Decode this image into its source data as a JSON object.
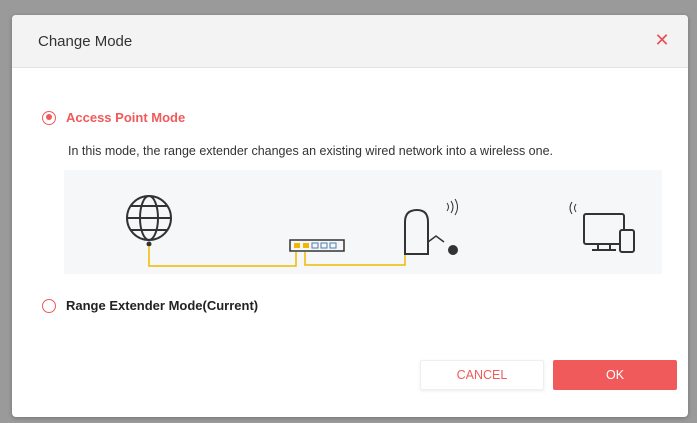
{
  "dialog": {
    "title": "Change Mode",
    "close_icon": "close-icon"
  },
  "options": [
    {
      "label": "Access Point Mode",
      "selected": true,
      "description": "In this mode, the range extender changes an existing wired network into a wireless one."
    },
    {
      "label": "Range Extender Mode(Current)",
      "selected": false
    }
  ],
  "diagram": {
    "icons": [
      "globe-icon",
      "switch-icon",
      "extender-icon",
      "wifi-signal-icon",
      "devices-icon"
    ]
  },
  "buttons": {
    "cancel": "CANCEL",
    "ok": "OK"
  },
  "colors": {
    "accent": "#f05a5a",
    "diagram_line": "#f0b800"
  }
}
